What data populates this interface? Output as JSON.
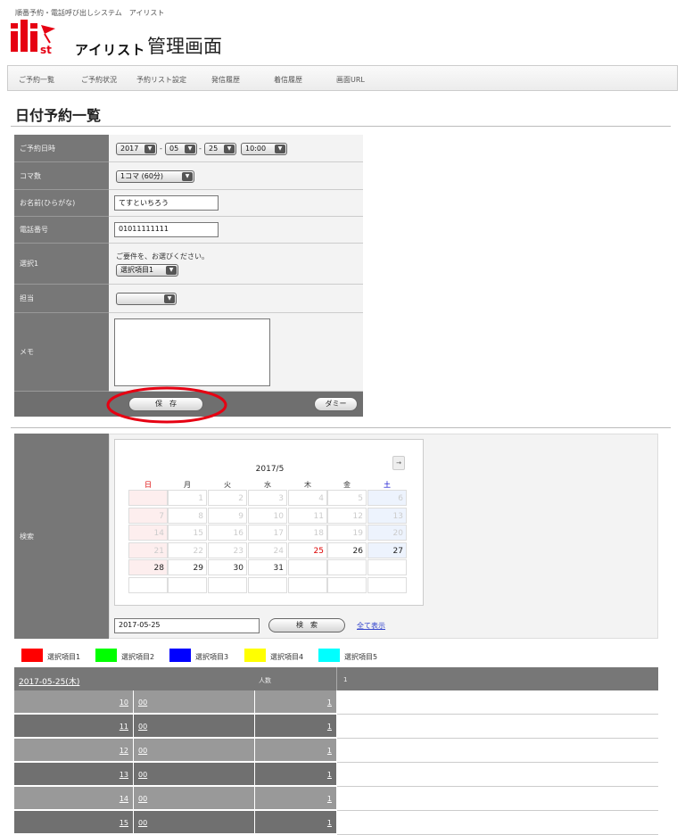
{
  "header": {
    "tagline": "順番予約・電話呼び出しシステム　アイリスト",
    "logo_text": "ilist",
    "brand": "アイリスト",
    "admin_title": "管理画面"
  },
  "nav": [
    "ご予約一覧",
    "ご予約状況",
    "予約リスト設定",
    "発信履歴",
    "着信履歴",
    "画面URL"
  ],
  "page_title": "日付予約一覧",
  "form": {
    "date_label": "ご予約日時",
    "year": "2017",
    "month": "05",
    "day": "25",
    "time": "10:00",
    "slots_label": "コマ数",
    "slots_value": "1コマ (60分)",
    "name_label": "お名前(ひらがな)",
    "name_value": "てすといちろう",
    "phone_label": "電話番号",
    "phone_value": "01011111111",
    "select1_label": "選択1",
    "select1_prompt": "ご要件を、お選びください。",
    "select1_value": "選択項目1",
    "staff_label": "担当",
    "staff_value": "",
    "memo_label": "メモ",
    "memo_value": "",
    "save_label": "保　存",
    "dummy_label": "ダミー"
  },
  "search": {
    "label": "検索",
    "calendar_title": "2017/5",
    "next_label": "→",
    "weekdays": [
      "日",
      "月",
      "火",
      "水",
      "木",
      "金",
      "土"
    ],
    "weeks": [
      [
        "",
        "1",
        "2",
        "3",
        "4",
        "5",
        "6"
      ],
      [
        "7",
        "8",
        "9",
        "10",
        "11",
        "12",
        "13"
      ],
      [
        "14",
        "15",
        "16",
        "17",
        "18",
        "19",
        "20"
      ],
      [
        "21",
        "22",
        "23",
        "24",
        "25",
        "26",
        "27"
      ],
      [
        "28",
        "29",
        "30",
        "31",
        "",
        "",
        ""
      ],
      [
        "",
        "",
        "",
        "",
        "",
        "",
        ""
      ]
    ],
    "date_value": "2017-05-25",
    "search_label": "検　索",
    "show_all_label": "全て表示"
  },
  "legend": [
    {
      "label": "選択項目1",
      "color": "#ff0000"
    },
    {
      "label": "選択項目2",
      "color": "#00ff00"
    },
    {
      "label": "選択項目3",
      "color": "#0000ff"
    },
    {
      "label": "選択項目4",
      "color": "#ffff00"
    },
    {
      "label": "選択項目5",
      "color": "#00ffff"
    }
  ],
  "schedule": {
    "date_link": "2017-05-25(木)",
    "count_header": "人数",
    "count_value": "1",
    "rows": [
      {
        "hour": "10",
        "minute": "00",
        "count": "1"
      },
      {
        "hour": "11",
        "minute": "00",
        "count": "1"
      },
      {
        "hour": "12",
        "minute": "00",
        "count": "1"
      },
      {
        "hour": "13",
        "minute": "00",
        "count": "1"
      },
      {
        "hour": "14",
        "minute": "00",
        "count": "1"
      },
      {
        "hour": "15",
        "minute": "00",
        "count": "1"
      }
    ]
  }
}
